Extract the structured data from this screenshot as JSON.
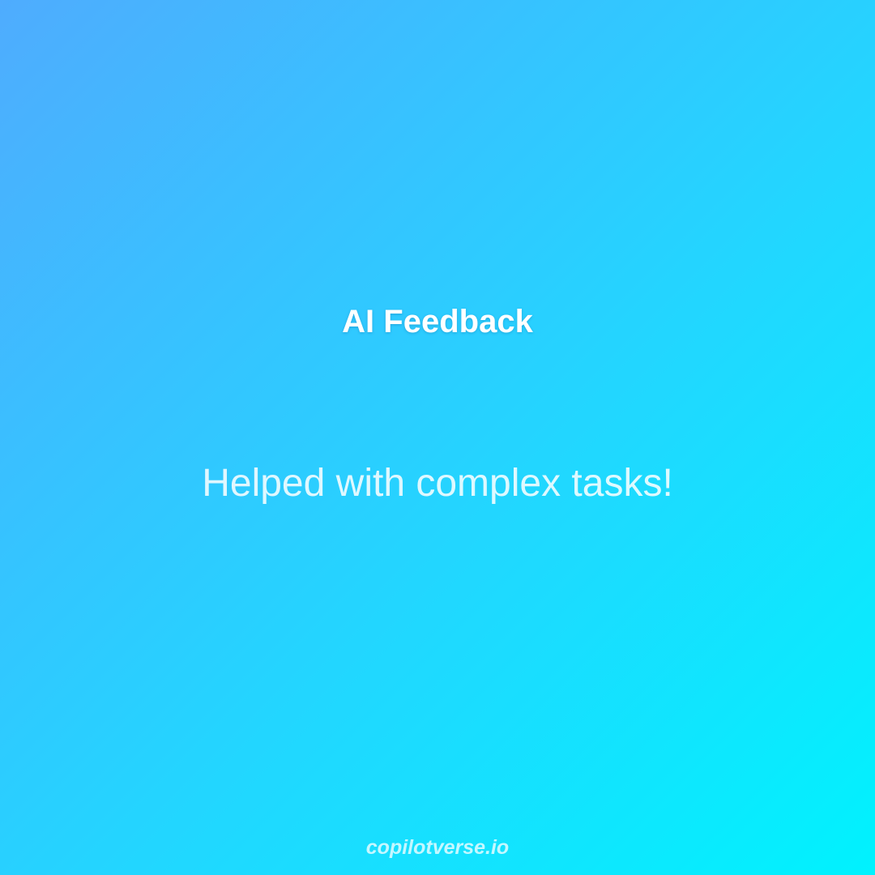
{
  "card": {
    "title": "AI Feedback",
    "message": "Helped with complex tasks!",
    "footer": "copilotverse.io"
  },
  "colors": {
    "gradient_start": "#4facfe",
    "gradient_end": "#00f2fe",
    "title_text": "#ffffff"
  }
}
